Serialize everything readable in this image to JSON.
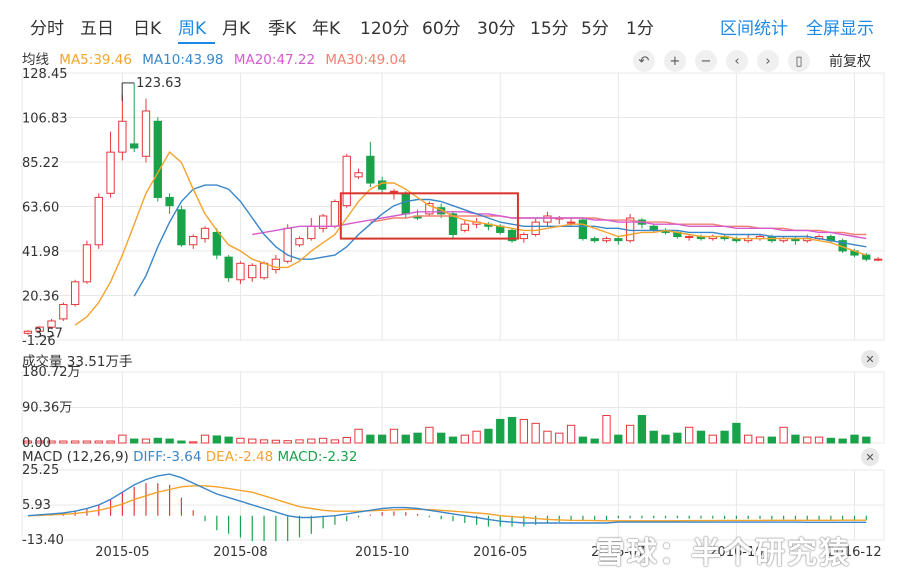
{
  "tabs": [
    {
      "label": "分时"
    },
    {
      "label": "五日"
    },
    {
      "label": "日K"
    },
    {
      "label": "周K",
      "active": true
    },
    {
      "label": "月K"
    },
    {
      "label": "季K"
    },
    {
      "label": "年K"
    },
    {
      "label": "120分"
    },
    {
      "label": "60分"
    },
    {
      "label": "30分"
    },
    {
      "label": "15分"
    },
    {
      "label": "5分"
    },
    {
      "label": "1分"
    }
  ],
  "tab_actions": {
    "range_stats": "区间统计",
    "fullscreen": "全屏显示"
  },
  "ma_legend": {
    "title": "均线",
    "ma5": "MA5:39.46",
    "ma10": "MA10:43.98",
    "ma20": "MA20:47.22",
    "ma30": "MA30:49.04"
  },
  "toolbar": {
    "adjust_label": "前复权"
  },
  "colors": {
    "up": "#e5383b",
    "down": "#19a24a",
    "ma5": "#f4a32c",
    "ma10": "#3a86c8",
    "ma20": "#d45bd0",
    "ma30": "#f08070",
    "macd_diff": "#3a86c8",
    "macd_dea": "#f4a32c",
    "tab_active": "#1e88e5",
    "grid": "#e8e8e8"
  },
  "volume_panel": {
    "label": "成交量 33.51万手"
  },
  "macd_panel": {
    "title": "MACD (12,26,9)",
    "diff": "DIFF:-3.64",
    "dea": "DEA:-2.48",
    "macd": "MACD:-2.32"
  },
  "watermark": "雪球：半个研究猿",
  "chart_data": {
    "type": "candlestick",
    "x_tick_labels": [
      "2015-05",
      "2015-08",
      "2015-10",
      "2016-05",
      "2016-07",
      "2016-10",
      "2016-12"
    ],
    "x_tick_index": [
      8,
      18,
      30,
      40,
      50,
      60,
      70
    ],
    "price_axis": {
      "ticks": [
        "128.45",
        "106.83",
        "85.22",
        "63.60",
        "41.98",
        "20.36",
        "-1.26"
      ],
      "tick_values": [
        128.45,
        106.83,
        85.22,
        63.6,
        41.98,
        20.36,
        -1.26
      ],
      "low_label": "3.57",
      "ylim": [
        -1.26,
        128.45
      ]
    },
    "max_annotation": {
      "label": "123.63",
      "index": 9,
      "value": 123.63
    },
    "candles": [
      {
        "o": 2,
        "c": 3,
        "h": 3.6,
        "l": 1.2
      },
      {
        "o": 3,
        "c": 5,
        "h": 5.5,
        "l": 2
      },
      {
        "o": 5,
        "c": 8,
        "h": 9,
        "l": 4
      },
      {
        "o": 9,
        "c": 16,
        "h": 17,
        "l": 8
      },
      {
        "o": 16,
        "c": 27,
        "h": 28,
        "l": 15
      },
      {
        "o": 27,
        "c": 45,
        "h": 47,
        "l": 26
      },
      {
        "o": 45,
        "c": 68,
        "h": 70,
        "l": 43
      },
      {
        "o": 70,
        "c": 90,
        "h": 100,
        "l": 68
      },
      {
        "o": 90,
        "c": 105,
        "h": 118,
        "l": 86
      },
      {
        "o": 94,
        "c": 92,
        "h": 123.63,
        "l": 90
      },
      {
        "o": 88,
        "c": 110,
        "h": 116,
        "l": 85
      },
      {
        "o": 105,
        "c": 68,
        "h": 107,
        "l": 66
      },
      {
        "o": 68,
        "c": 64,
        "h": 70,
        "l": 60
      },
      {
        "o": 62,
        "c": 45,
        "h": 64,
        "l": 44
      },
      {
        "o": 45,
        "c": 49,
        "h": 50,
        "l": 43
      },
      {
        "o": 48,
        "c": 53,
        "h": 54,
        "l": 46
      },
      {
        "o": 51,
        "c": 40,
        "h": 53,
        "l": 38
      },
      {
        "o": 39,
        "c": 29,
        "h": 40,
        "l": 27
      },
      {
        "o": 28,
        "c": 36,
        "h": 37,
        "l": 26
      },
      {
        "o": 29,
        "c": 35,
        "h": 36,
        "l": 27
      },
      {
        "o": 29,
        "c": 36,
        "h": 37,
        "l": 28
      },
      {
        "o": 33,
        "c": 38,
        "h": 40,
        "l": 31
      },
      {
        "o": 37,
        "c": 53,
        "h": 55,
        "l": 36
      },
      {
        "o": 45,
        "c": 48,
        "h": 49,
        "l": 44
      },
      {
        "o": 48,
        "c": 54,
        "h": 58,
        "l": 47
      },
      {
        "o": 53,
        "c": 59,
        "h": 60,
        "l": 51
      },
      {
        "o": 54,
        "c": 66,
        "h": 67,
        "l": 53
      },
      {
        "o": 64,
        "c": 88,
        "h": 89,
        "l": 63
      },
      {
        "o": 78,
        "c": 80,
        "h": 82,
        "l": 77
      },
      {
        "o": 88,
        "c": 75,
        "h": 95,
        "l": 73
      },
      {
        "o": 76,
        "c": 72,
        "h": 78,
        "l": 70
      },
      {
        "o": 71,
        "c": 71,
        "h": 72,
        "l": 67
      },
      {
        "o": 70,
        "c": 60,
        "h": 71,
        "l": 58
      },
      {
        "o": 59,
        "c": 58,
        "h": 62,
        "l": 57
      },
      {
        "o": 60,
        "c": 65,
        "h": 66,
        "l": 59
      },
      {
        "o": 63,
        "c": 60,
        "h": 65,
        "l": 58
      },
      {
        "o": 60,
        "c": 50,
        "h": 61,
        "l": 48
      },
      {
        "o": 52,
        "c": 55,
        "h": 57,
        "l": 51
      },
      {
        "o": 55,
        "c": 56,
        "h": 58,
        "l": 53
      },
      {
        "o": 55,
        "c": 54,
        "h": 56,
        "l": 52
      },
      {
        "o": 54,
        "c": 51,
        "h": 55,
        "l": 50
      },
      {
        "o": 52,
        "c": 47,
        "h": 53,
        "l": 46
      },
      {
        "o": 48,
        "c": 50,
        "h": 51,
        "l": 46
      },
      {
        "o": 50,
        "c": 56,
        "h": 58,
        "l": 49
      },
      {
        "o": 56,
        "c": 59,
        "h": 61,
        "l": 54
      },
      {
        "o": 58,
        "c": 58,
        "h": 59,
        "l": 55
      },
      {
        "o": 56,
        "c": 56,
        "h": 58,
        "l": 54
      },
      {
        "o": 57,
        "c": 48,
        "h": 58,
        "l": 47
      },
      {
        "o": 48,
        "c": 47,
        "h": 49,
        "l": 46
      },
      {
        "o": 47,
        "c": 48,
        "h": 49,
        "l": 46
      },
      {
        "o": 48,
        "c": 47,
        "h": 49,
        "l": 45
      },
      {
        "o": 47,
        "c": 58,
        "h": 60,
        "l": 46
      },
      {
        "o": 57,
        "c": 55,
        "h": 58,
        "l": 53
      },
      {
        "o": 54,
        "c": 52,
        "h": 55,
        "l": 51
      },
      {
        "o": 52,
        "c": 51,
        "h": 53,
        "l": 50
      },
      {
        "o": 51,
        "c": 49,
        "h": 52,
        "l": 48
      },
      {
        "o": 49,
        "c": 49,
        "h": 50,
        "l": 47
      },
      {
        "o": 49,
        "c": 48,
        "h": 50,
        "l": 47
      },
      {
        "o": 48,
        "c": 49,
        "h": 50,
        "l": 47
      },
      {
        "o": 49,
        "c": 48,
        "h": 50,
        "l": 47
      },
      {
        "o": 48,
        "c": 47,
        "h": 49,
        "l": 46
      },
      {
        "o": 47,
        "c": 48,
        "h": 50,
        "l": 46
      },
      {
        "o": 48,
        "c": 49,
        "h": 50,
        "l": 47
      },
      {
        "o": 49,
        "c": 47,
        "h": 50,
        "l": 46
      },
      {
        "o": 47,
        "c": 48,
        "h": 49,
        "l": 46
      },
      {
        "o": 48,
        "c": 47,
        "h": 49,
        "l": 45
      },
      {
        "o": 47,
        "c": 48,
        "h": 50,
        "l": 46
      },
      {
        "o": 48,
        "c": 49,
        "h": 50,
        "l": 47
      },
      {
        "o": 49,
        "c": 47,
        "h": 50,
        "l": 46
      },
      {
        "o": 47,
        "c": 42,
        "h": 48,
        "l": 41
      },
      {
        "o": 42,
        "c": 40,
        "h": 43,
        "l": 39
      },
      {
        "o": 40,
        "c": 38,
        "h": 41,
        "l": 37
      },
      {
        "o": 38,
        "c": 38,
        "h": 39,
        "l": 37
      }
    ],
    "ma5": [
      null,
      null,
      null,
      null,
      6,
      10,
      17,
      27,
      40,
      55,
      70,
      80,
      90,
      85,
      72,
      60,
      52,
      45,
      42,
      38,
      36,
      34,
      34,
      37,
      42,
      46,
      50,
      58,
      66,
      72,
      75,
      75,
      72,
      68,
      64,
      62,
      59,
      57,
      56,
      55,
      54,
      53,
      52,
      52,
      53,
      54,
      55,
      55,
      53,
      51,
      49,
      50,
      51,
      51,
      52,
      51,
      50,
      49,
      49,
      49,
      48,
      48,
      48,
      48,
      48,
      48,
      48,
      47,
      46,
      44,
      42,
      40
    ],
    "ma10": [
      null,
      null,
      null,
      null,
      null,
      null,
      null,
      null,
      null,
      20,
      30,
      44,
      56,
      66,
      72,
      74,
      74,
      72,
      66,
      58,
      50,
      44,
      40,
      38,
      38,
      39,
      40,
      44,
      50,
      55,
      60,
      64,
      66,
      67,
      67,
      66,
      64,
      62,
      60,
      58,
      56,
      55,
      54,
      54,
      54,
      54,
      54,
      54,
      54,
      53,
      53,
      52,
      52,
      52,
      52,
      52,
      51,
      51,
      51,
      50,
      50,
      50,
      50,
      49,
      49,
      49,
      49,
      48,
      47,
      46,
      45,
      44
    ],
    "ma20": [
      null,
      null,
      null,
      null,
      null,
      null,
      null,
      null,
      null,
      null,
      null,
      null,
      null,
      null,
      null,
      null,
      null,
      null,
      null,
      50,
      51,
      52,
      53,
      54,
      54,
      54,
      54,
      55,
      56,
      57,
      58,
      59,
      60,
      61,
      61,
      61,
      61,
      61,
      60,
      60,
      59,
      58,
      58,
      58,
      58,
      58,
      58,
      58,
      57,
      57,
      56,
      56,
      56,
      55,
      55,
      55,
      54,
      54,
      54,
      54,
      53,
      53,
      53,
      53,
      52,
      52,
      52,
      51,
      51,
      50,
      49,
      48
    ],
    "ma30": [
      null,
      null,
      null,
      null,
      null,
      null,
      null,
      null,
      null,
      null,
      null,
      null,
      null,
      null,
      null,
      null,
      null,
      null,
      null,
      null,
      null,
      null,
      null,
      null,
      null,
      null,
      null,
      null,
      null,
      56,
      57,
      58,
      58,
      59,
      59,
      59,
      59,
      59,
      59,
      59,
      59,
      58,
      58,
      58,
      58,
      58,
      58,
      58,
      58,
      57,
      57,
      57,
      56,
      56,
      56,
      55,
      55,
      55,
      55,
      54,
      54,
      54,
      53,
      53,
      53,
      52,
      52,
      52,
      51,
      51,
      50,
      50
    ],
    "volume_axis": {
      "ticks": [
        "180.72万",
        "90.36万",
        "0.00"
      ],
      "tick_values": [
        180.72,
        90.36,
        0
      ],
      "ylim": [
        0,
        180.72
      ]
    },
    "volume": [
      5,
      5,
      5,
      5,
      5,
      5,
      5,
      5,
      20,
      10,
      10,
      12,
      10,
      5,
      3,
      20,
      18,
      15,
      12,
      10,
      8,
      7,
      6,
      8,
      10,
      12,
      8,
      14,
      35,
      20,
      20,
      35,
      20,
      25,
      40,
      25,
      15,
      20,
      30,
      35,
      60,
      65,
      60,
      50,
      30,
      25,
      45,
      15,
      10,
      70,
      20,
      45,
      70,
      30,
      20,
      25,
      40,
      30,
      20,
      30,
      50,
      20,
      15,
      15,
      40,
      20,
      15,
      15,
      12,
      10,
      20,
      15
    ],
    "macd_axis": {
      "ticks": [
        "25.25",
        "5.93",
        "-13.40"
      ],
      "tick_values": [
        25.25,
        5.93,
        -13.4
      ],
      "ylim": [
        -13.4,
        25.25
      ]
    },
    "diff": [
      0,
      0.5,
      1,
      1.5,
      2.5,
      4,
      6,
      9,
      13,
      17,
      20,
      22,
      23,
      21,
      18,
      15,
      12,
      10,
      8,
      6,
      4,
      2,
      0,
      -1,
      -1,
      -0.5,
      0,
      1,
      2,
      3,
      4,
      4.5,
      4.5,
      4,
      3,
      2,
      1,
      0,
      -1,
      -2,
      -3,
      -3.5,
      -4,
      -4,
      -4,
      -4,
      -4,
      -4,
      -4,
      -4,
      -3.5,
      -3.5,
      -3.5,
      -3.5,
      -3.5,
      -3.5,
      -3.5,
      -3.5,
      -3.5,
      -3.5,
      -3.5,
      -3.5,
      -3.5,
      -3.5,
      -3.5,
      -3.5,
      -3.6,
      -3.6,
      -3.6,
      -3.6,
      -3.64,
      -3.64
    ],
    "dea": [
      0,
      0.2,
      0.5,
      0.8,
      1.2,
      2,
      3,
      4.5,
      6.5,
      9,
      11,
      13,
      14.5,
      16,
      16.5,
      16.5,
      16,
      15,
      14,
      13,
      11,
      9,
      7,
      5,
      4,
      3,
      2.5,
      2.5,
      2.5,
      2.7,
      3,
      3.3,
      3.5,
      3.5,
      3.4,
      3,
      2.5,
      2,
      1.5,
      1,
      0,
      -0.5,
      -1,
      -1.5,
      -2,
      -2.3,
      -2.5,
      -2.6,
      -2.7,
      -2.8,
      -2.8,
      -2.8,
      -2.8,
      -2.8,
      -2.8,
      -2.8,
      -2.7,
      -2.7,
      -2.7,
      -2.6,
      -2.6,
      -2.6,
      -2.6,
      -2.5,
      -2.5,
      -2.5,
      -2.5,
      -2.5,
      -2.5,
      -2.48,
      -2.48,
      -2.48
    ],
    "highlight": {
      "start_index": 27,
      "end_index": 41,
      "top": 70,
      "bottom": 48
    }
  }
}
